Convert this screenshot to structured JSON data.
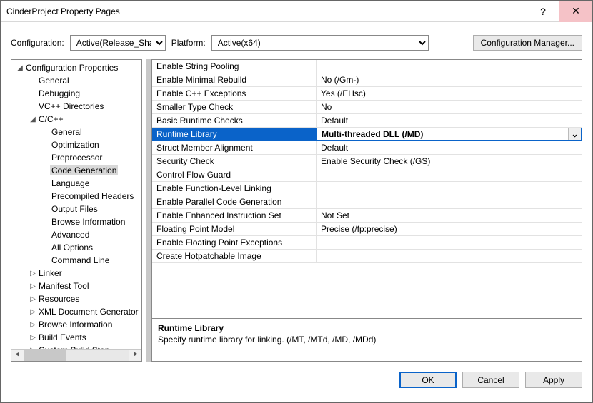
{
  "window": {
    "title": "CinderProject Property Pages",
    "help": "?",
    "close": "✕"
  },
  "configbar": {
    "config_label": "Configuration:",
    "config_value": "Active(Release_Shared)",
    "platform_label": "Platform:",
    "platform_value": "Active(x64)",
    "manager_label": "Configuration Manager..."
  },
  "tree": [
    {
      "label": "Configuration Properties",
      "depth": 0,
      "twist": "◢"
    },
    {
      "label": "General",
      "depth": 1,
      "twist": ""
    },
    {
      "label": "Debugging",
      "depth": 1,
      "twist": ""
    },
    {
      "label": "VC++ Directories",
      "depth": 1,
      "twist": ""
    },
    {
      "label": "C/C++",
      "depth": 1,
      "twist": "◢"
    },
    {
      "label": "General",
      "depth": 2,
      "twist": ""
    },
    {
      "label": "Optimization",
      "depth": 2,
      "twist": ""
    },
    {
      "label": "Preprocessor",
      "depth": 2,
      "twist": ""
    },
    {
      "label": "Code Generation",
      "depth": 2,
      "twist": "",
      "selected": true
    },
    {
      "label": "Language",
      "depth": 2,
      "twist": ""
    },
    {
      "label": "Precompiled Headers",
      "depth": 2,
      "twist": ""
    },
    {
      "label": "Output Files",
      "depth": 2,
      "twist": ""
    },
    {
      "label": "Browse Information",
      "depth": 2,
      "twist": ""
    },
    {
      "label": "Advanced",
      "depth": 2,
      "twist": ""
    },
    {
      "label": "All Options",
      "depth": 2,
      "twist": ""
    },
    {
      "label": "Command Line",
      "depth": 2,
      "twist": ""
    },
    {
      "label": "Linker",
      "depth": 1,
      "twist": "▷"
    },
    {
      "label": "Manifest Tool",
      "depth": 1,
      "twist": "▷"
    },
    {
      "label": "Resources",
      "depth": 1,
      "twist": "▷"
    },
    {
      "label": "XML Document Generator",
      "depth": 1,
      "twist": "▷"
    },
    {
      "label": "Browse Information",
      "depth": 1,
      "twist": "▷"
    },
    {
      "label": "Build Events",
      "depth": 1,
      "twist": "▷"
    },
    {
      "label": "Custom Build Step",
      "depth": 1,
      "twist": "▷"
    }
  ],
  "properties": [
    {
      "name": "Enable String Pooling",
      "value": ""
    },
    {
      "name": "Enable Minimal Rebuild",
      "value": "No (/Gm-)"
    },
    {
      "name": "Enable C++ Exceptions",
      "value": "Yes (/EHsc)"
    },
    {
      "name": "Smaller Type Check",
      "value": "No"
    },
    {
      "name": "Basic Runtime Checks",
      "value": "Default"
    },
    {
      "name": "Runtime Library",
      "value": "Multi-threaded DLL (/MD)",
      "selected": true,
      "dropdown": true
    },
    {
      "name": "Struct Member Alignment",
      "value": "Default"
    },
    {
      "name": "Security Check",
      "value": "Enable Security Check (/GS)"
    },
    {
      "name": "Control Flow Guard",
      "value": ""
    },
    {
      "name": "Enable Function-Level Linking",
      "value": ""
    },
    {
      "name": "Enable Parallel Code Generation",
      "value": ""
    },
    {
      "name": "Enable Enhanced Instruction Set",
      "value": "Not Set"
    },
    {
      "name": "Floating Point Model",
      "value": "Precise (/fp:precise)"
    },
    {
      "name": "Enable Floating Point Exceptions",
      "value": ""
    },
    {
      "name": "Create Hotpatchable Image",
      "value": ""
    }
  ],
  "description": {
    "title": "Runtime Library",
    "text": "Specify runtime library for linking.     (/MT, /MTd, /MD, /MDd)"
  },
  "footer": {
    "ok": "OK",
    "cancel": "Cancel",
    "apply": "Apply"
  },
  "glyphs": {
    "left": "⯇",
    "right": "⯈",
    "ddown": "⌄"
  }
}
